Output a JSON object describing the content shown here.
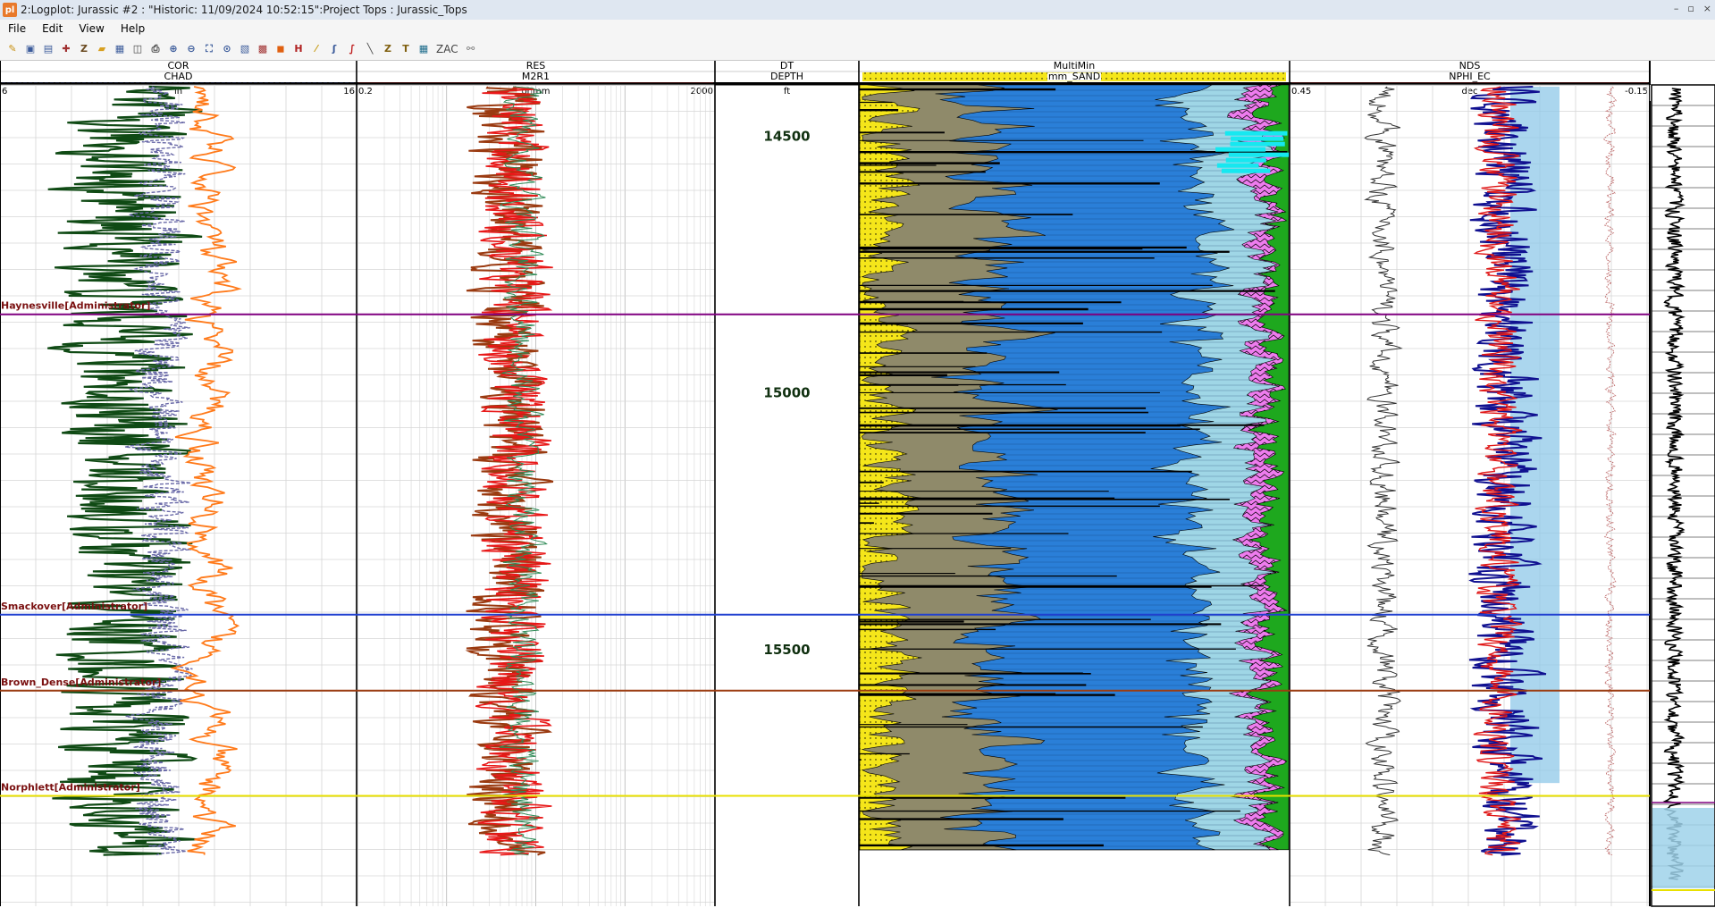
{
  "window": {
    "app_icon_text": "pl",
    "title": "2:Logplot: Jurassic #2 : \"Historic: 11/09/2024 10:52:15\":Project Tops : Jurassic_Tops",
    "controls": [
      "–",
      "▫",
      "×"
    ]
  },
  "menu": [
    "File",
    "Edit",
    "View",
    "Help"
  ],
  "toolbar": {
    "icons": [
      "open-icon",
      "save-icon",
      "print-setup-icon",
      "edit-icon",
      "z-edit-icon",
      "folder-icon",
      "page-icon",
      "print-preview-icon",
      "print-icon",
      "zoom-in-icon",
      "zoom-out-icon",
      "zoom-fit-icon",
      "zoom-window-icon",
      "pencil-box-icon",
      "color-icon",
      "fill-icon",
      "hash-icon",
      "brush-icon",
      "curve-icon",
      "spline-icon",
      "line-icon",
      "z-icon",
      "t-icon",
      "grid-icon"
    ],
    "zac_label": "ZAC"
  },
  "tracks": [
    {
      "title": "COR",
      "curve": "CHAD",
      "unit": "in",
      "scale_left": "6",
      "scale_right": "16",
      "curve_color": "#2a3a8c"
    },
    {
      "title": "RES",
      "curve": "M2R1",
      "unit": "ohmm",
      "scale_left": "0.2",
      "scale_right": "2000",
      "curve_color": "#e02020"
    },
    {
      "title": "DT",
      "curve": "DEPTH",
      "unit": "ft",
      "scale_left": "",
      "scale_right": "",
      "curve_color": "#000000"
    },
    {
      "title": "MultiMin",
      "curve": "mm_SAND",
      "unit": "",
      "scale_left": "0",
      "scale_right": "1",
      "curve_color": "#f0e000"
    },
    {
      "title": "NDS",
      "curve": "NPHI_EC",
      "unit": "dec",
      "scale_left": "0.45",
      "scale_right": "-0.15",
      "curve_color": "#e02020"
    }
  ],
  "depth_labels": [
    "14500",
    "15000",
    "15500"
  ],
  "depth_values": [
    14500,
    15000,
    15500
  ],
  "depth_range": [
    14400,
    16000
  ],
  "formation_tops": [
    {
      "name": "Haynesville[Administrator]",
      "depth": 14847,
      "color": "#800080"
    },
    {
      "name": "Smackover[Administrator]",
      "depth": 15432,
      "color": "#2040d0"
    },
    {
      "name": "Brown_Dense[Administrator]",
      "depth": 15580,
      "color": "#9c3c10"
    },
    {
      "name": "Norphlett[Administrator]",
      "depth": 15785,
      "color": "#e8e000"
    }
  ],
  "colors": {
    "sand": "#f5e61a",
    "shale": "#8f8a6a",
    "limestone": "#2a7fd8",
    "dolomite": "#9fd6e6",
    "anhydrite": "#ee7cee",
    "coal": "#000000",
    "salt": "#1ea81e",
    "bright": "#16e8f0",
    "cor_dark": "#0f4a14",
    "cor_orange": "#ff7a1a",
    "res_brown": "#9a3a10",
    "res_green": "#2e8a56",
    "nds_blue": "#101090"
  }
}
